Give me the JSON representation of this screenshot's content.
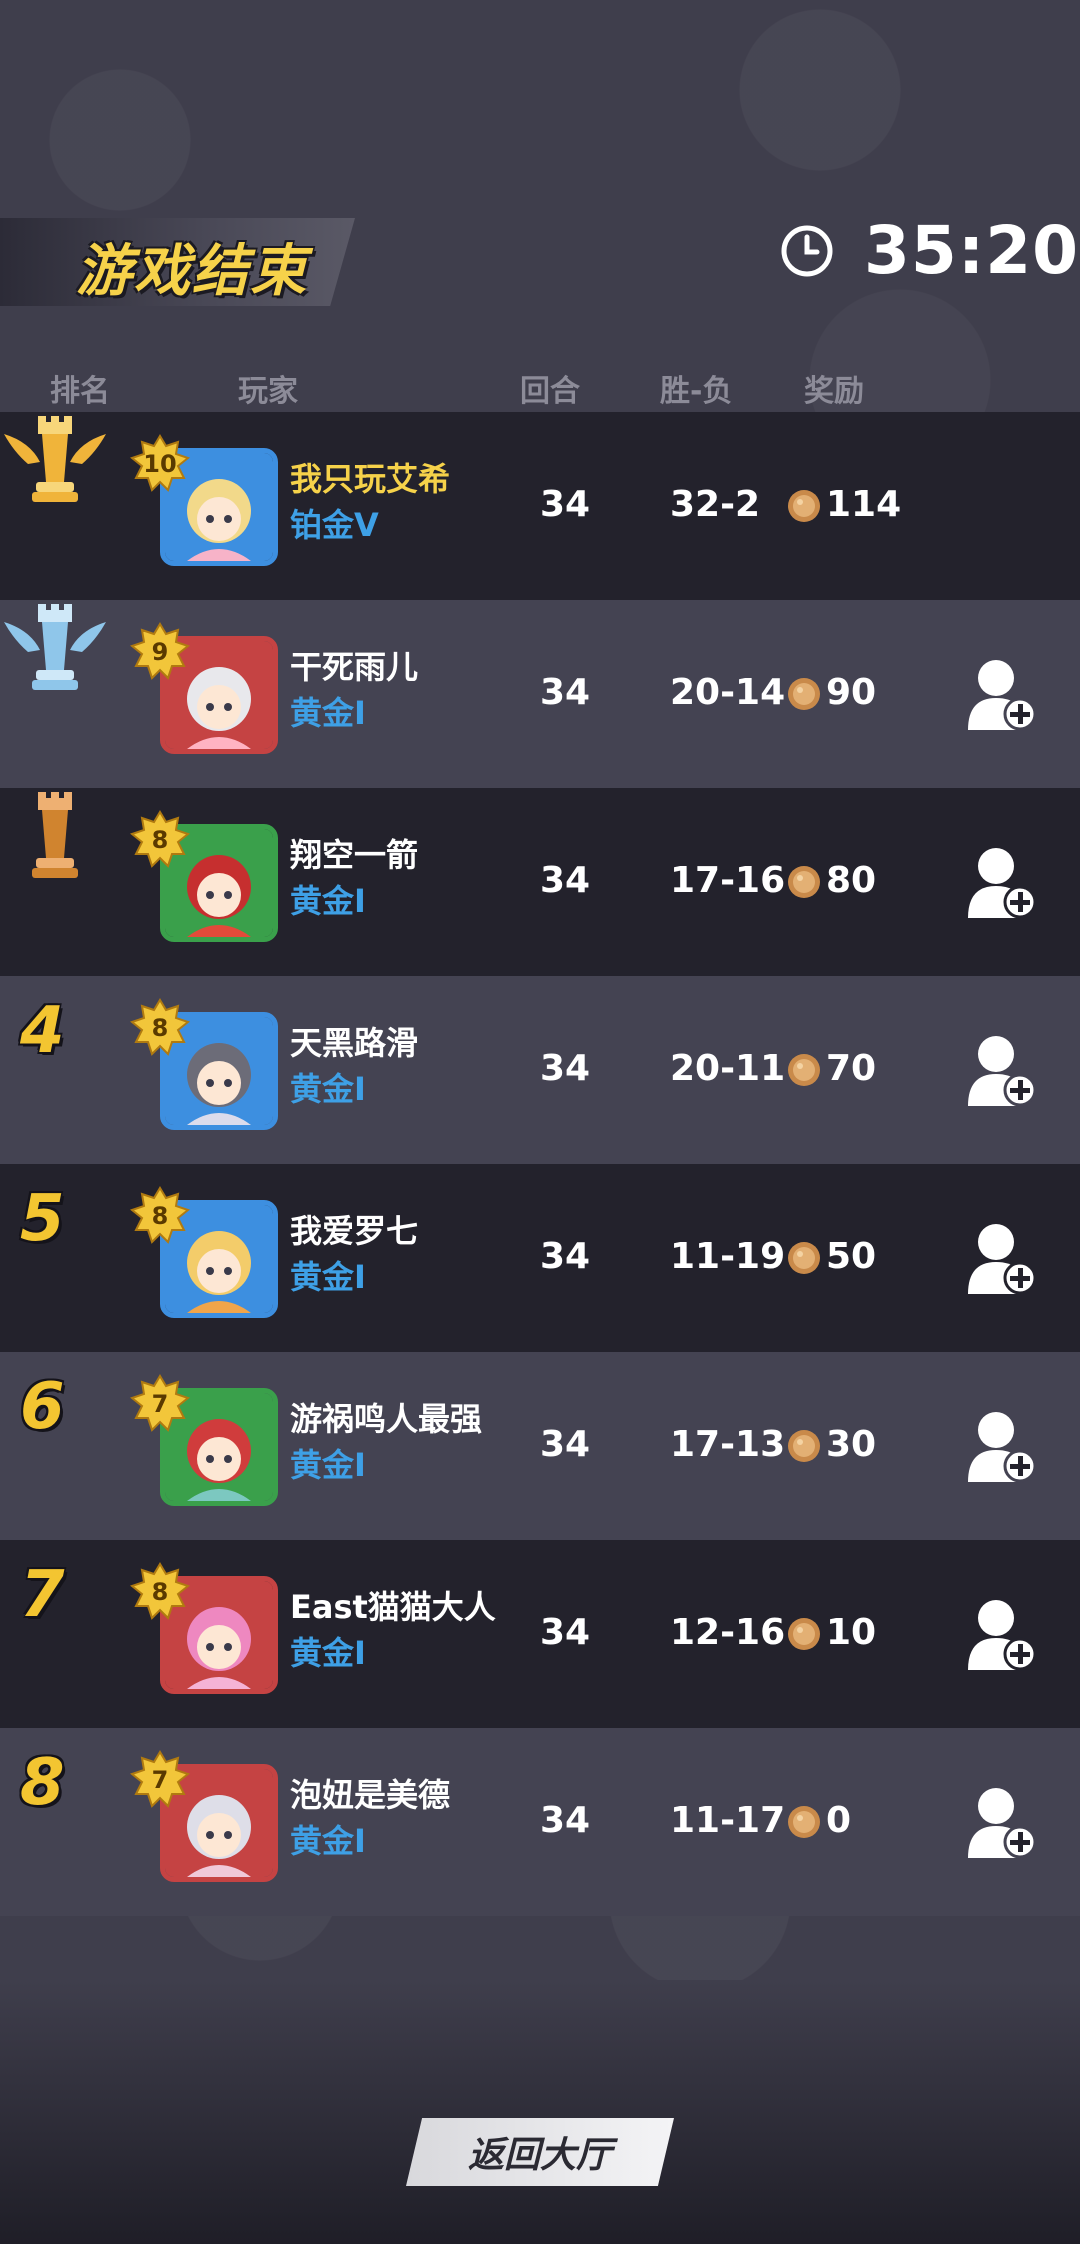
{
  "header": {
    "title": "游戏结束",
    "timer": "35:20"
  },
  "columns": {
    "rank": "排名",
    "player": "玩家",
    "rounds": "回合",
    "winloss": "胜-负",
    "reward": "奖励"
  },
  "rows": [
    {
      "rank": "1",
      "level": "10",
      "name": "我只玩艾希",
      "tier": "铂金V",
      "rounds": "34",
      "winloss": "32-2",
      "reward": "114",
      "rank_icon": "gold-rook-wings-icon",
      "add_friend": false
    },
    {
      "rank": "2",
      "level": "9",
      "name": "干死雨儿",
      "tier": "黄金I",
      "rounds": "34",
      "winloss": "20-14",
      "reward": "90",
      "rank_icon": "silver-rook-wings-icon",
      "add_friend": true
    },
    {
      "rank": "3",
      "level": "8",
      "name": "翔空一箭",
      "tier": "黄金I",
      "rounds": "34",
      "winloss": "17-16",
      "reward": "80",
      "rank_icon": "bronze-rook-icon",
      "add_friend": true
    },
    {
      "rank": "4",
      "level": "8",
      "name": "天黑路滑",
      "tier": "黄金I",
      "rounds": "34",
      "winloss": "20-11",
      "reward": "70",
      "add_friend": true
    },
    {
      "rank": "5",
      "level": "8",
      "name": "我爱罗七",
      "tier": "黄金I",
      "rounds": "34",
      "winloss": "11-19",
      "reward": "50",
      "add_friend": true
    },
    {
      "rank": "6",
      "level": "7",
      "name": "游祸鸣人最强",
      "tier": "黄金I",
      "rounds": "34",
      "winloss": "17-13",
      "reward": "30",
      "add_friend": true
    },
    {
      "rank": "7",
      "level": "8",
      "name": "East猫猫大人",
      "tier": "黄金I",
      "rounds": "34",
      "winloss": "12-16",
      "reward": "10",
      "add_friend": true
    },
    {
      "rank": "8",
      "level": "7",
      "name": "泡妞是美德",
      "tier": "黄金I",
      "rounds": "34",
      "winloss": "11-17",
      "reward": "0",
      "add_friend": true
    }
  ],
  "footer": {
    "back_label": "返回大厅"
  },
  "colors": {
    "gold": "#f6d24a",
    "tier_blue": "#3ea0e6",
    "row_dark": "#23222c",
    "row_light": "#444352",
    "background": "#3f3e4c"
  }
}
